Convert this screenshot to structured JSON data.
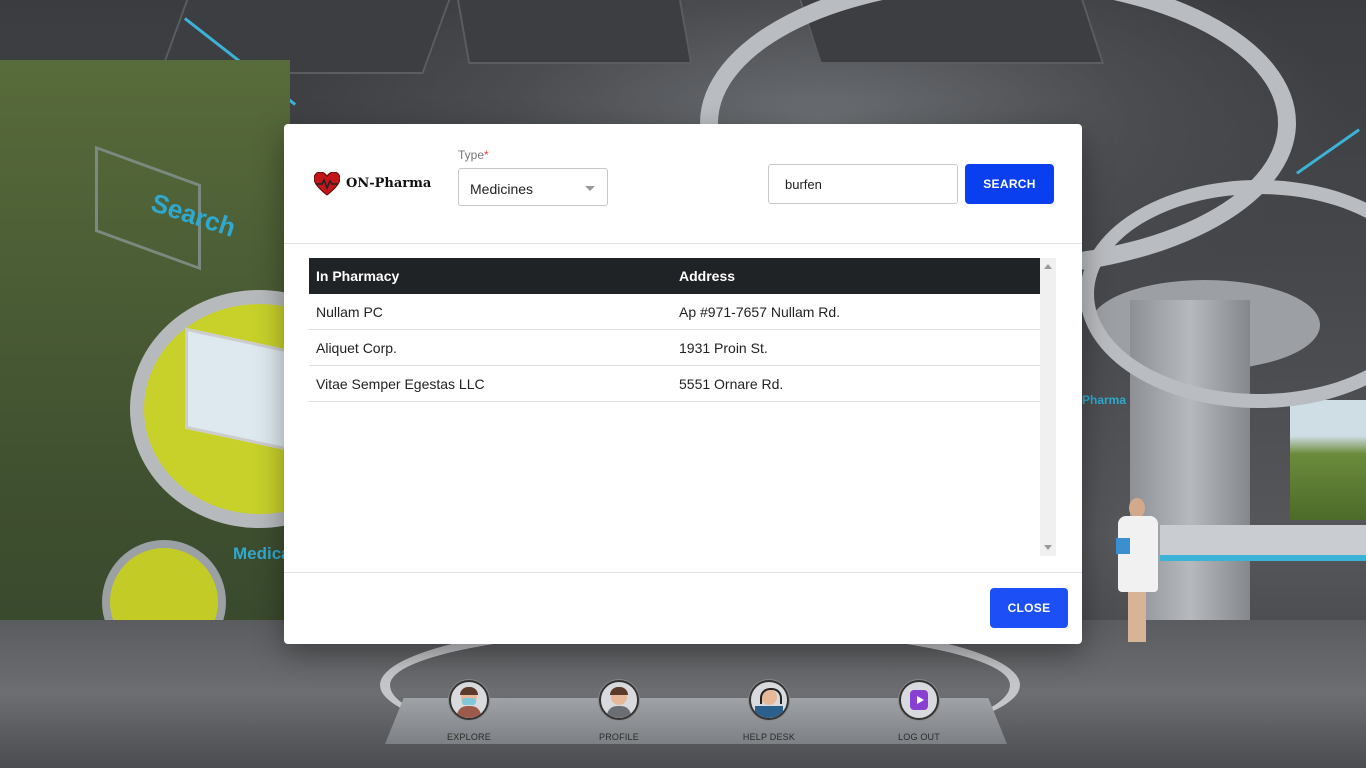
{
  "brand": {
    "name": "ON-Pharma"
  },
  "filter": {
    "type_label": "Type",
    "required_mark": "*",
    "type_value": "Medicines"
  },
  "search": {
    "query": "burfen",
    "button_label": "SEARCH"
  },
  "table": {
    "columns": [
      "In Pharmacy",
      "Address"
    ],
    "rows": [
      {
        "pharmacy": "Nullam PC",
        "address": "Ap #971-7657 Nullam Rd."
      },
      {
        "pharmacy": "Aliquet Corp.",
        "address": "1931 Proin St."
      },
      {
        "pharmacy": "Vitae Semper Egestas LLC",
        "address": "5551 Ornare Rd."
      }
    ]
  },
  "footer": {
    "close_label": "CLOSE"
  },
  "background_signs": {
    "search": "Search",
    "medical": "Medica",
    "pharma": "Pharma"
  },
  "dock": {
    "items": [
      {
        "label": "EXPLORE",
        "icon": "explore-icon"
      },
      {
        "label": "PROFILE",
        "icon": "profile-icon"
      },
      {
        "label": "HELP DESK",
        "icon": "help-desk-icon"
      },
      {
        "label": "LOG OUT",
        "icon": "logout-icon"
      }
    ]
  },
  "colors": {
    "primary_button": "#0a3ff0",
    "table_header": "#1f2326",
    "required": "#e0443c"
  }
}
